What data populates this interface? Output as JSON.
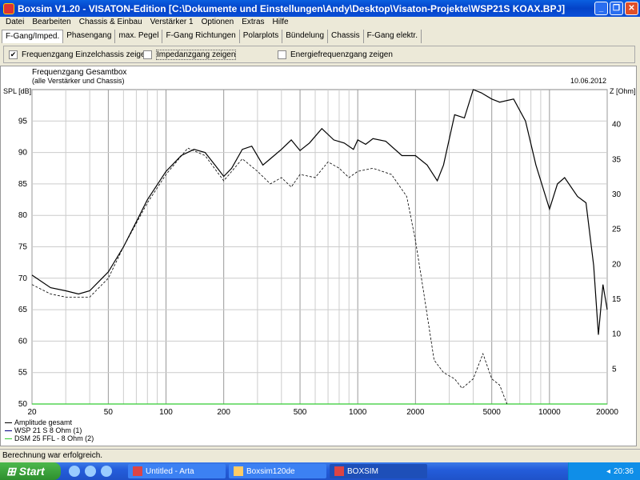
{
  "window": {
    "title": "Boxsim V1.20 - VISATON-Edition [C:\\Dokumente und Einstellungen\\Andy\\Desktop\\Visaton-Projekte\\WSP21S KOAX.BPJ]",
    "minimize": "_",
    "restore": "❐",
    "close": "✕"
  },
  "menu": [
    "Datei",
    "Bearbeiten",
    "Chassis & Einbau",
    "Verstärker 1",
    "Optionen",
    "Extras",
    "Hilfe"
  ],
  "tabs": [
    "F-Gang/Imped.",
    "Phasengang",
    "max. Pegel",
    "F-Gang Richtungen",
    "Polarplots",
    "Bündelung",
    "Chassis",
    "F-Gang elektr."
  ],
  "options": [
    {
      "label": "Frequenzgang Einzelchassis zeigen",
      "checked": true
    },
    {
      "label": "Impedanzgang zeigen",
      "checked": false
    },
    {
      "label": "Energiefrequenzgang zeigen",
      "checked": false
    }
  ],
  "legend": [
    {
      "label": "Amplitude gesamt",
      "color": "#000000"
    },
    {
      "label": "WSP 21 S 8 Ohm (1)",
      "color": "#000080"
    },
    {
      "label": "DSM 25 FFL - 8 Ohm (2)",
      "color": "#33cc33"
    }
  ],
  "status": "Berechnung war erfolgreich.",
  "taskbar": {
    "start": "Start",
    "tasks": [
      "Untitled - Arta",
      "Boxsim120de",
      "BOXSIM"
    ],
    "clock": "20:36"
  },
  "chart_data": {
    "type": "line",
    "title": "Frequenzgang Gesamtbox",
    "subtitle": "(alle Verstärker und Chassis)",
    "date": "10.06.2012",
    "ylabel": "SPL [dB]",
    "y2label": "Z [Ohm]",
    "xscale": "log",
    "xlim": [
      20,
      20000
    ],
    "ylim": [
      50,
      100
    ],
    "y2lim": [
      0,
      45
    ],
    "xticks": [
      20,
      50,
      100,
      200,
      500,
      1000,
      2000,
      5000,
      10000,
      20000
    ],
    "yticks": [
      50,
      55,
      60,
      65,
      70,
      75,
      80,
      85,
      90,
      95
    ],
    "y2ticks": [
      5,
      10,
      15,
      20,
      25,
      30,
      35,
      40
    ],
    "series": [
      {
        "name": "Amplitude gesamt",
        "style": "solid",
        "color": "#000000",
        "x": [
          20,
          25,
          30,
          35,
          40,
          50,
          60,
          70,
          80,
          100,
          120,
          140,
          160,
          180,
          200,
          220,
          250,
          280,
          320,
          350,
          400,
          450,
          500,
          560,
          650,
          750,
          850,
          950,
          1000,
          1100,
          1200,
          1400,
          1700,
          2000,
          2300,
          2600,
          2800,
          3200,
          3600,
          4000,
          4400,
          5000,
          5500,
          6500,
          7500,
          8500,
          10000,
          11000,
          12000,
          14000,
          15500,
          17000,
          18000,
          19000,
          20000
        ],
        "y": [
          70.5,
          68.5,
          68,
          67.5,
          68,
          71,
          75,
          79,
          82.5,
          87,
          89.5,
          90.5,
          90,
          88,
          86.2,
          87.5,
          90.5,
          91,
          88,
          89,
          90.5,
          92,
          90.3,
          91.5,
          93.8,
          92,
          91.5,
          90.5,
          92,
          91.3,
          92.2,
          91.8,
          89.5,
          89.5,
          88,
          85.5,
          88,
          96,
          95.5,
          100,
          99.5,
          98.5,
          98,
          98.5,
          95,
          88,
          81,
          85,
          86,
          83,
          82,
          72,
          61,
          69,
          65
        ]
      },
      {
        "name": "WSP 21 S 8 Ohm (1)",
        "style": "dashed",
        "color": "#000000",
        "x": [
          20,
          25,
          30,
          40,
          50,
          60,
          80,
          100,
          130,
          160,
          200,
          250,
          300,
          350,
          400,
          450,
          500,
          600,
          700,
          800,
          900,
          1000,
          1200,
          1500,
          1800,
          2000,
          2200,
          2500,
          2800,
          3200,
          3500,
          4000,
          4500,
          5000,
          5500,
          6000
        ],
        "y": [
          69,
          67.5,
          67,
          67,
          70,
          75,
          82,
          86.5,
          90.7,
          89.5,
          85.5,
          89,
          87,
          85,
          86,
          84.5,
          86.5,
          86,
          88.5,
          87.5,
          86,
          87,
          87.5,
          86.5,
          83,
          76,
          68,
          57,
          55,
          54,
          52.5,
          54,
          58,
          54,
          53,
          50
        ]
      },
      {
        "name": "DSM 25 FFL - 8 Ohm (2)",
        "style": "solid",
        "color": "#33cc33",
        "x": [
          20,
          20000
        ],
        "y": [
          50,
          50
        ]
      }
    ]
  }
}
